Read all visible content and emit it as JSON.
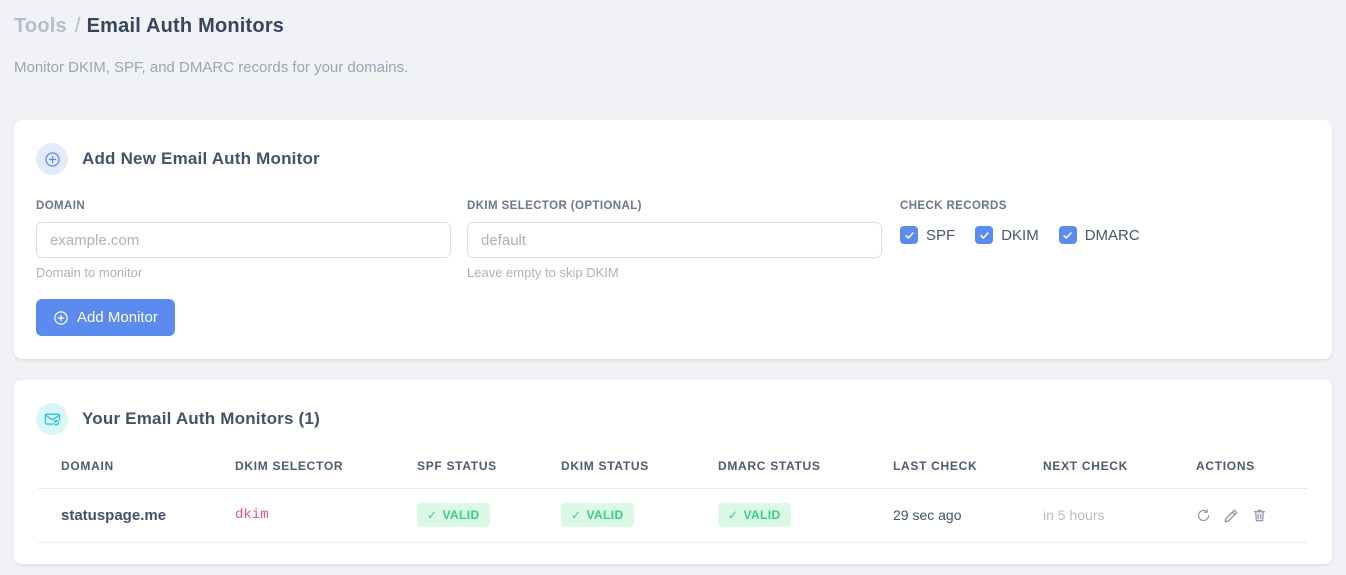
{
  "header": {
    "breadcrumb": {
      "root": "Tools",
      "separator": "/",
      "current": "Email Auth Monitors"
    },
    "subtitle": "Monitor DKIM, SPF, and DMARC records for your domains."
  },
  "add_monitor_card": {
    "title": "Add New Email Auth Monitor",
    "domain_field": {
      "label": "DOMAIN",
      "placeholder": "example.com",
      "value": "",
      "helper": "Domain to monitor"
    },
    "dkim_field": {
      "label": "DKIM SELECTOR (OPTIONAL)",
      "placeholder": "default",
      "value": "",
      "helper": "Leave empty to skip DKIM"
    },
    "check_records": {
      "label": "CHECK RECORDS",
      "options": [
        {
          "label": "SPF",
          "checked": true
        },
        {
          "label": "DKIM",
          "checked": true
        },
        {
          "label": "DMARC",
          "checked": true
        }
      ]
    },
    "submit_label": "Add Monitor"
  },
  "monitors_card": {
    "title": "Your Email Auth Monitors (1)",
    "count": 1,
    "columns": [
      "DOMAIN",
      "DKIM SELECTOR",
      "SPF STATUS",
      "DKIM STATUS",
      "DMARC STATUS",
      "LAST CHECK",
      "NEXT CHECK",
      "ACTIONS"
    ],
    "status_glyph": "✓",
    "rows": [
      {
        "domain": "statuspage.me",
        "dkim_selector": "dkim",
        "spf_status": "VALID",
        "dkim_status": "VALID",
        "dmarc_status": "VALID",
        "last_check": "29 sec ago",
        "next_check": "in 5 hours"
      }
    ]
  },
  "icons": {
    "add_badge": "plus-circle-icon",
    "monitors_badge": "envelope-check-icon",
    "row_actions": [
      "refresh-icon",
      "edit-pencil-icon",
      "trash-icon"
    ]
  },
  "colors": {
    "accent_blue": "#5b8bef",
    "accent_cyan": "#26c6da",
    "success_text": "#2fd47f",
    "success_bg": "#dcf9e7",
    "selector_pink": "#ed4f87",
    "page_bg": "#f0f2f5",
    "card_bg": "#ffffff"
  }
}
